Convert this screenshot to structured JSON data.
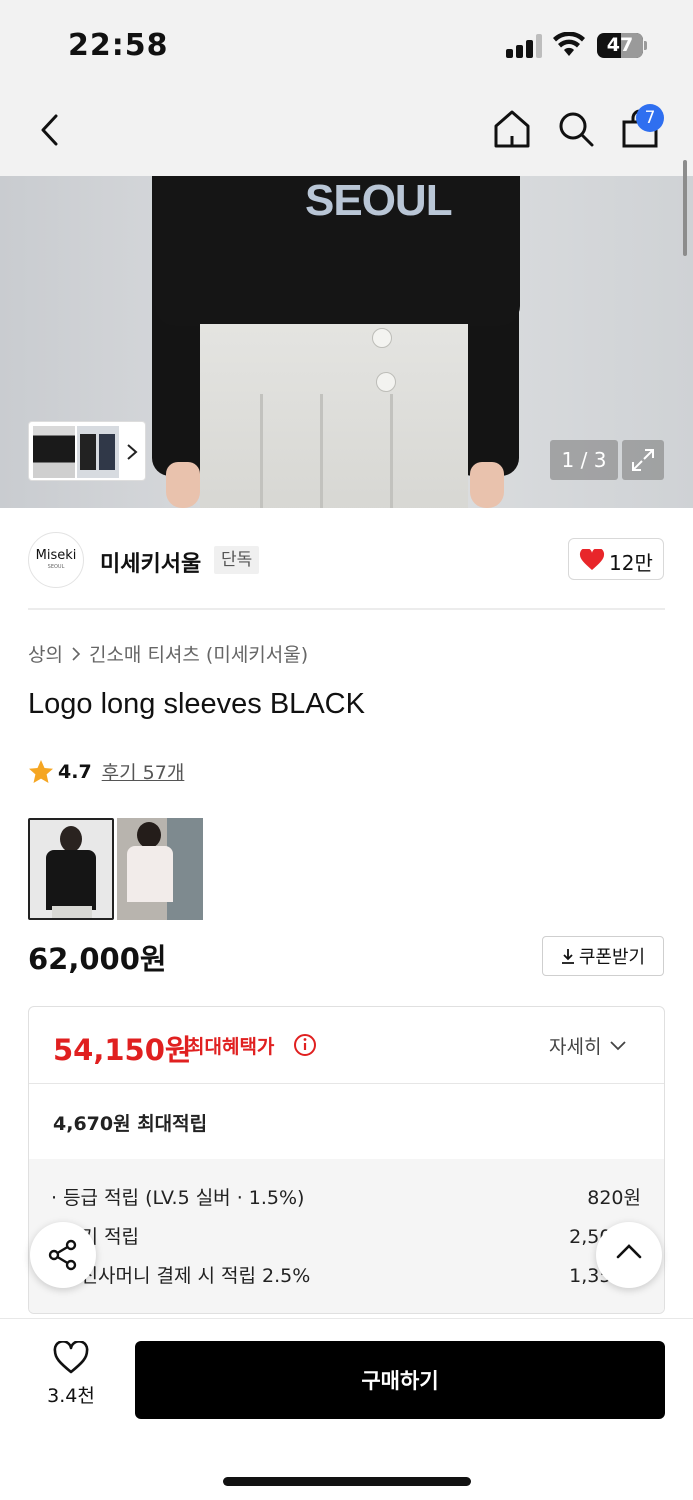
{
  "status": {
    "time": "22:58",
    "battery": "47"
  },
  "nav": {
    "cart_count": "7"
  },
  "gallery": {
    "counter": "1 / 3",
    "hero_text": "SEOUL"
  },
  "brand": {
    "logo_text": "Miseki",
    "logo_sub": "SEOUL",
    "name": "미세키서울",
    "badge": "단독",
    "likes": "12만"
  },
  "breadcrumb": {
    "category": "상의",
    "subcategory": "긴소매 티셔츠 (미세키서울)"
  },
  "product": {
    "title": "Logo long sleeves BLACK",
    "price": "62,000원"
  },
  "rating": {
    "score": "4.7",
    "reviews": "후기 57개"
  },
  "coupon": {
    "label": "쿠폰받기"
  },
  "benefit": {
    "max_price": "54,150원",
    "max_label": "최대혜택가",
    "detail_label": "자세히",
    "points_max": "4,670원 최대적립",
    "rows": [
      {
        "label": "· 등급 적립 (LV.5 실버 · 1.5%)",
        "value": "820원"
      },
      {
        "label": "· 후기 적립",
        "value": "2,500원"
      },
      {
        "label": "· 무신사머니 결제 시 적립 2.5%",
        "value": "1,350원"
      }
    ]
  },
  "bottom": {
    "wish_count": "3.4천",
    "buy_label": "구매하기"
  },
  "colors": {
    "accent_red": "#e02020",
    "badge_blue": "#2f6ff0",
    "heart_red": "#e8262a"
  }
}
